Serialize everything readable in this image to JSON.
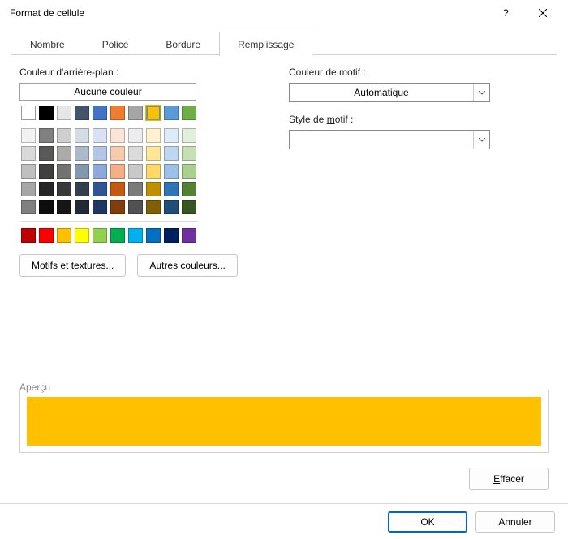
{
  "title": "Format de cellule",
  "tabs": {
    "number": "Nombre",
    "font": "Police",
    "border": "Bordure",
    "fill": "Remplissage"
  },
  "left": {
    "bg_label": "Couleur d'arrière-plan :",
    "nocolor": "Aucune couleur",
    "fill_effects_pre": "Moti",
    "fill_effects_u": "f",
    "fill_effects_post": "s et textures...",
    "more_colors_u": "A",
    "more_colors_post": "utres couleurs..."
  },
  "right": {
    "pattern_color_label": "Couleur de motif :",
    "pattern_color_value": "Automatique",
    "pattern_style_label_pre": "Style de ",
    "pattern_style_label_u": "m",
    "pattern_style_label_post": "otif :",
    "pattern_style_value": ""
  },
  "preview_label": "Aperçu",
  "preview_color": "#FFC000",
  "clear_u": "E",
  "clear_post": "ffacer",
  "ok": "OK",
  "cancel": "Annuler",
  "theme_row1": [
    "#FFFFFF",
    "#000000",
    "#E7E6E6",
    "#44546A",
    "#4472C4",
    "#ED7D31",
    "#A5A5A5",
    "#FFC000",
    "#5B9BD5",
    "#70AD47"
  ],
  "theme_shades": [
    [
      "#F2F2F2",
      "#808080",
      "#D0CECE",
      "#D6DCE4",
      "#D9E1F2",
      "#FCE4D6",
      "#EDEDED",
      "#FFF2CC",
      "#DDEBF7",
      "#E2EFDA"
    ],
    [
      "#D9D9D9",
      "#595959",
      "#AEAAAA",
      "#ACB9CA",
      "#B4C6E7",
      "#F8CBAD",
      "#DBDBDB",
      "#FFE699",
      "#BDD7EE",
      "#C6E0B4"
    ],
    [
      "#BFBFBF",
      "#404040",
      "#757171",
      "#8497B0",
      "#8EA9DB",
      "#F4B084",
      "#C9C9C9",
      "#FFD966",
      "#9BC2E6",
      "#A9D08E"
    ],
    [
      "#A6A6A6",
      "#262626",
      "#3A3838",
      "#333F4F",
      "#305496",
      "#C65911",
      "#7B7B7B",
      "#BF8F00",
      "#2F75B5",
      "#548235"
    ],
    [
      "#808080",
      "#0D0D0D",
      "#161616",
      "#222B35",
      "#203764",
      "#833C0C",
      "#525252",
      "#806000",
      "#1F4E78",
      "#375623"
    ]
  ],
  "standard": [
    "#C00000",
    "#FF0000",
    "#FFC000",
    "#FFFF00",
    "#92D050",
    "#00B050",
    "#00B0F0",
    "#0070C0",
    "#002060",
    "#7030A0"
  ]
}
